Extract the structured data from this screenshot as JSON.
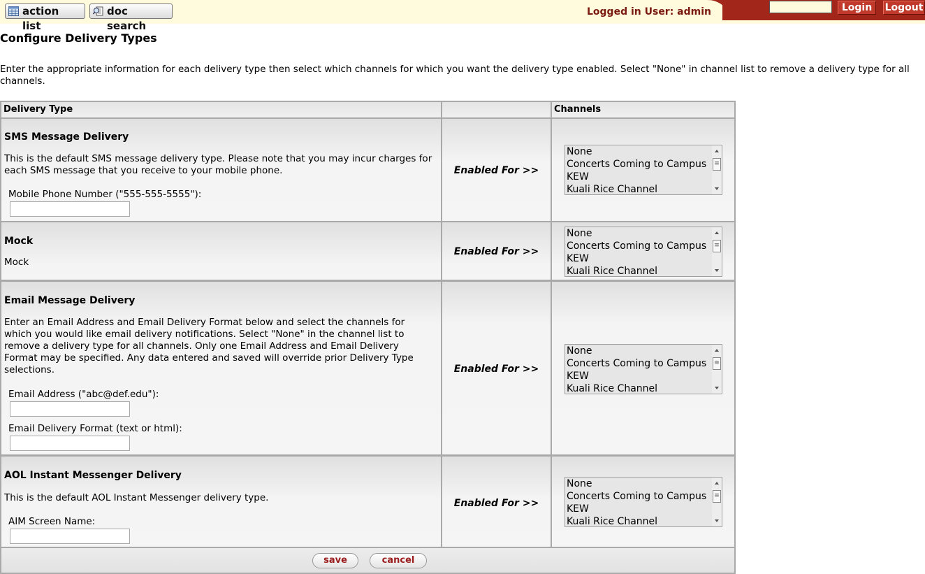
{
  "header": {
    "action_list_label": "action list",
    "doc_search_label": "doc search",
    "logged_in_text": "Logged in User: admin",
    "login_input_value": "",
    "login_label": "Login",
    "logout_label": "Logout",
    "colors": {
      "banner_bg": "#fffbdc",
      "banner_red": "#a3261b",
      "button_red": "#c0392b"
    }
  },
  "page": {
    "title": "Configure Delivery Types",
    "intro": "Enter the appropriate information for each delivery type then select which channels for which you want the delivery type enabled. Select \"None\" in channel list to remove a delivery type for all channels."
  },
  "table": {
    "headers": {
      "delivery_type": "Delivery Type",
      "middle": "",
      "channels": "Channels"
    },
    "enabled_label": "Enabled For >>",
    "channel_options": [
      "None",
      "Concerts Coming to Campus",
      "KEW",
      "Kuali Rice Channel"
    ],
    "rows": [
      {
        "title": "SMS Message Delivery",
        "description": "This is the default SMS message delivery type. Please note that you may incur charges for each SMS message that you receive to your mobile phone.",
        "fields": [
          {
            "label": "Mobile Phone Number (\"555-555-5555\"):",
            "value": ""
          }
        ]
      },
      {
        "title": "Mock",
        "description": "Mock",
        "fields": []
      },
      {
        "title": "Email Message Delivery",
        "description": "Enter an Email Address and Email Delivery Format below and select the channels for which you would like email delivery notifications. Select \"None\" in the channel list to remove a delivery type for all channels. Only one Email Address and Email Delivery Format may be specified. Any data entered and saved will override prior Delivery Type selections.",
        "fields": [
          {
            "label": "Email Address (\"abc@def.edu\"):",
            "value": ""
          },
          {
            "label": "Email Delivery Format (text or html):",
            "value": ""
          }
        ]
      },
      {
        "title": "AOL Instant Messenger Delivery",
        "description": "This is the default AOL Instant Messenger delivery type.",
        "fields": [
          {
            "label": "AIM Screen Name:",
            "value": ""
          }
        ]
      }
    ]
  },
  "footer": {
    "save_label": "save",
    "cancel_label": "cancel"
  }
}
